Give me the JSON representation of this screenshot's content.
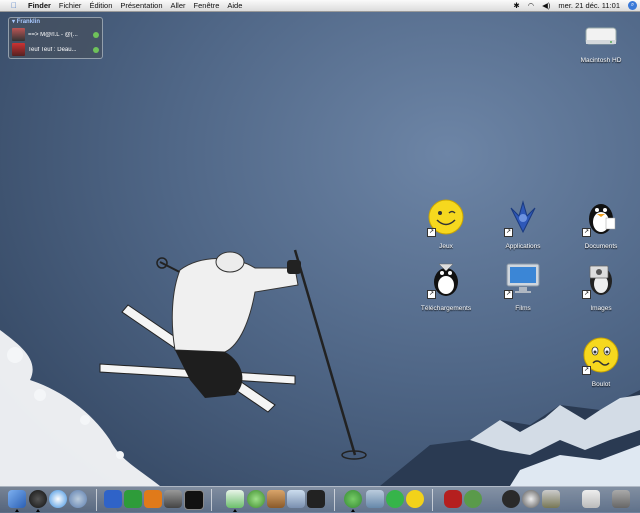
{
  "menubar": {
    "apple": "",
    "items": [
      "Finder",
      "Fichier",
      "Édition",
      "Présentation",
      "Aller",
      "Fenêtre",
      "Aide"
    ],
    "clock": "mer. 21 déc. 11:01"
  },
  "buddy_list": {
    "group": "Franklin",
    "buddies": [
      {
        "name": "==> M@rl.L - @(..."
      },
      {
        "name": "Teuf Teuf : Deau..."
      }
    ]
  },
  "desktop_icons": {
    "hd": "Macintosh HD",
    "jeux": "Jeux",
    "applications": "Applications",
    "documents": "Documents",
    "telechargements": "Téléchargements",
    "films": "Films",
    "images": "Images",
    "boulot": "Boulot"
  },
  "colors": {
    "desktop_bg": "#4f6686",
    "menubar": "#e8e8e8",
    "online": "#6fc25a"
  },
  "dock_items": [
    "finder-icon",
    "dashboard-icon",
    "safari-icon",
    "mail-icon",
    "word-icon",
    "excel-icon",
    "powerpoint-icon",
    "system-prefs-icon",
    "terminal-icon",
    "itunes-icon",
    "xcode-icon",
    "iphoto-icon",
    "imovie-icon",
    "dvd-player-icon",
    "adium-icon",
    "preview-icon",
    "skype-icon",
    "duck-icon",
    "car-icon",
    "game-icon",
    "dog-icon",
    "sheep-icon",
    "tools-icon",
    "apple-icon",
    "trash-icon"
  ]
}
